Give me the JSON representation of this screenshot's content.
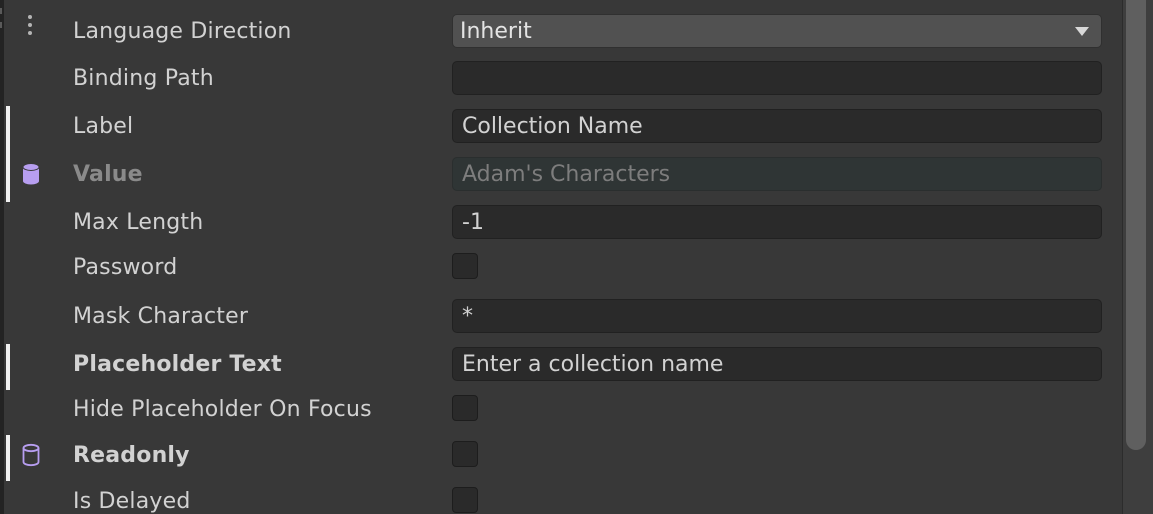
{
  "rows": {
    "language_direction": {
      "label": "Language Direction",
      "value": "Inherit"
    },
    "binding_path": {
      "label": "Binding Path",
      "value": ""
    },
    "label": {
      "label": "Label",
      "value": "Collection Name"
    },
    "value": {
      "label": "Value",
      "value": "Adam's Characters"
    },
    "max_length": {
      "label": "Max Length",
      "value": "-1"
    },
    "password": {
      "label": "Password",
      "checked": false
    },
    "mask_character": {
      "label": "Mask Character",
      "value": "*"
    },
    "placeholder_text": {
      "label": "Placeholder Text",
      "value": "Enter a collection name"
    },
    "hide_placeholder_on_focus": {
      "label": "Hide Placeholder On Focus",
      "checked": false
    },
    "readonly": {
      "label": "Readonly",
      "checked": false
    },
    "is_delayed": {
      "label": "Is Delayed",
      "checked": false
    }
  },
  "icons": {
    "kebab": "more-options-icon",
    "database_filled": "database-binding-icon",
    "database_outline": "database-outline-icon",
    "dropdown_arrow": "dropdown-arrow-icon"
  },
  "colors": {
    "background": "#383838",
    "field": "#2a2a2a",
    "override_bar": "#f0f0f0",
    "binding_icon": "#b79ef0"
  }
}
